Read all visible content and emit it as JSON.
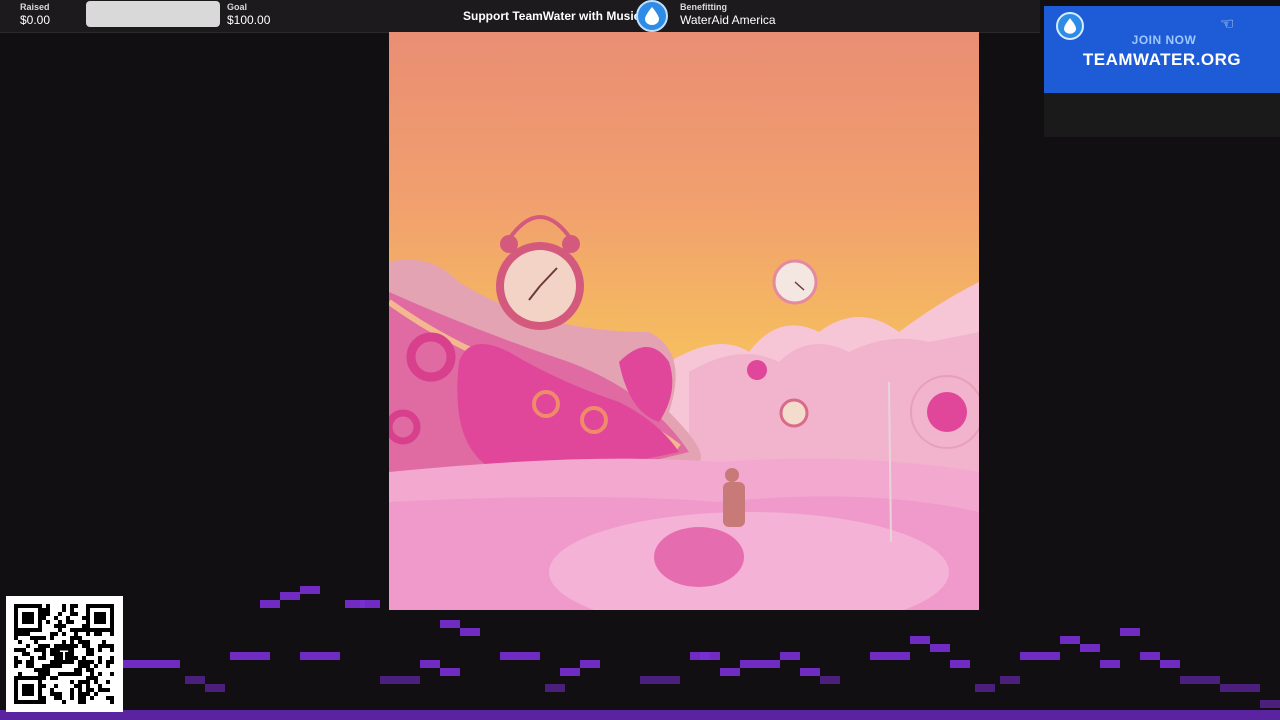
{
  "topbar": {
    "raised_label": "Raised",
    "raised_value": "$0.00",
    "progress_fraction": 0,
    "goal_label": "Goal",
    "goal_value": "$100.00",
    "title": "Support TeamWater with Music",
    "benefit_label": "Benefitting",
    "benefit_value": "WaterAid America"
  },
  "ad": {
    "join_text": "JOIN NOW",
    "url_text": "TEAMWATER.ORG",
    "badge_icon": "water-drop-icon",
    "pointer_icon": "pointing-hand-icon",
    "background_color": "#1e5bd6"
  },
  "qr": {
    "icon": "qr-code-icon",
    "center_mark": "T"
  },
  "colors": {
    "accent": "#2e8be6",
    "visualizer": "#7a2fd6"
  }
}
